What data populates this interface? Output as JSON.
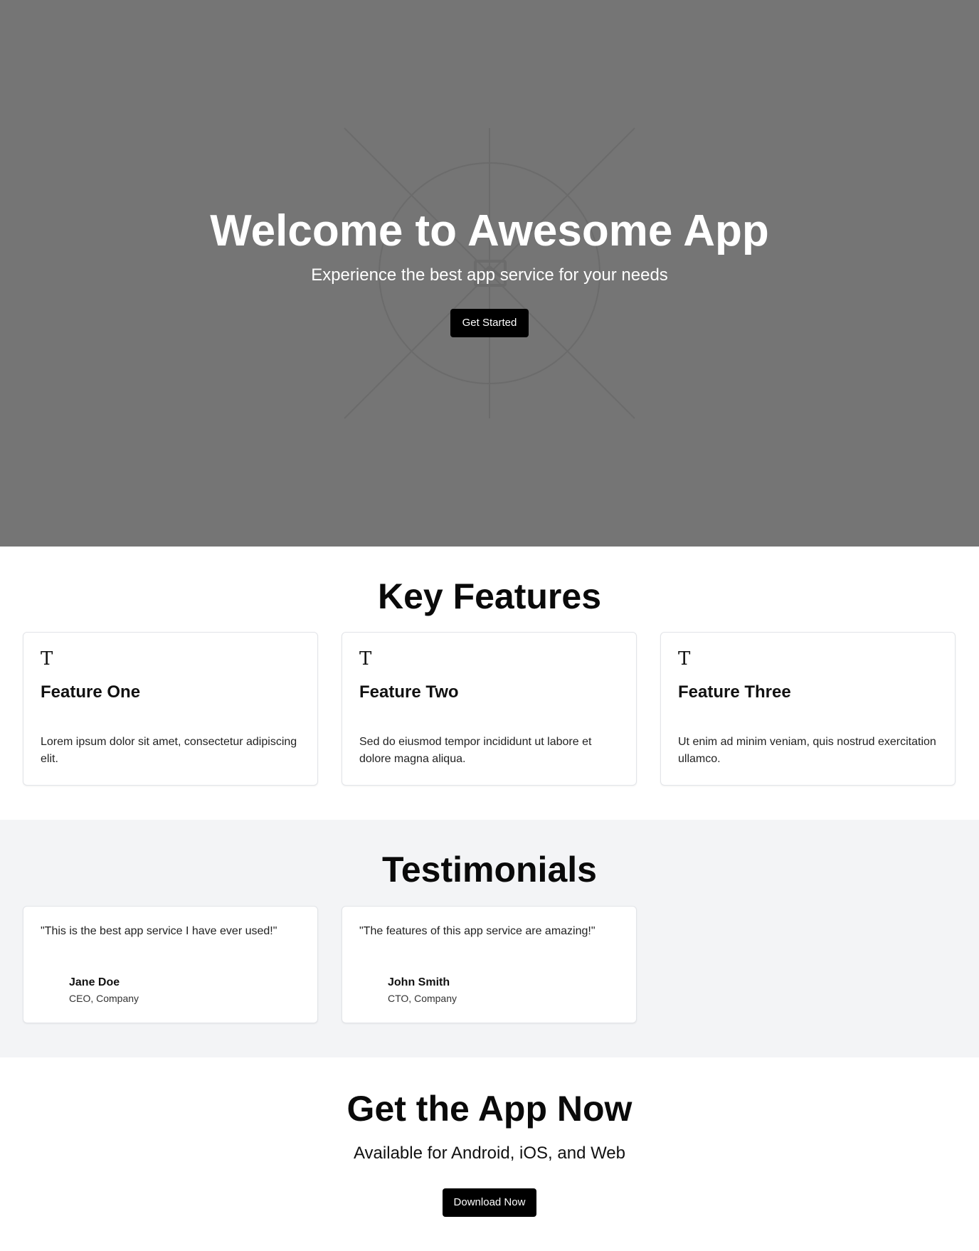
{
  "hero": {
    "title": "Welcome to Awesome App",
    "subtitle": "Experience the best app service for your needs",
    "cta_label": "Get Started",
    "background_color": "#757575",
    "background_icon": "image-placeholder-icon"
  },
  "features": {
    "heading": "Key Features",
    "items": [
      {
        "icon": "T",
        "title": "Feature One",
        "description": "Lorem ipsum dolor sit amet, consectetur adipiscing elit."
      },
      {
        "icon": "T",
        "title": "Feature Two",
        "description": "Sed do eiusmod tempor incididunt ut labore et dolore magna aliqua."
      },
      {
        "icon": "T",
        "title": "Feature Three",
        "description": "Ut enim ad minim veniam, quis nostrud exercitation ullamco."
      }
    ]
  },
  "testimonials": {
    "heading": "Testimonials",
    "background_color": "#f3f4f6",
    "items": [
      {
        "quote": "\"This is the best app service I have ever used!\"",
        "name": "Jane Doe",
        "role": "CEO, Company"
      },
      {
        "quote": "\"The features of this app service are amazing!\"",
        "name": "John Smith",
        "role": "CTO, Company"
      }
    ]
  },
  "cta": {
    "heading": "Get the App Now",
    "subtitle": "Available for Android, iOS, and Web",
    "button_label": "Download Now",
    "button_color": "#000000"
  }
}
